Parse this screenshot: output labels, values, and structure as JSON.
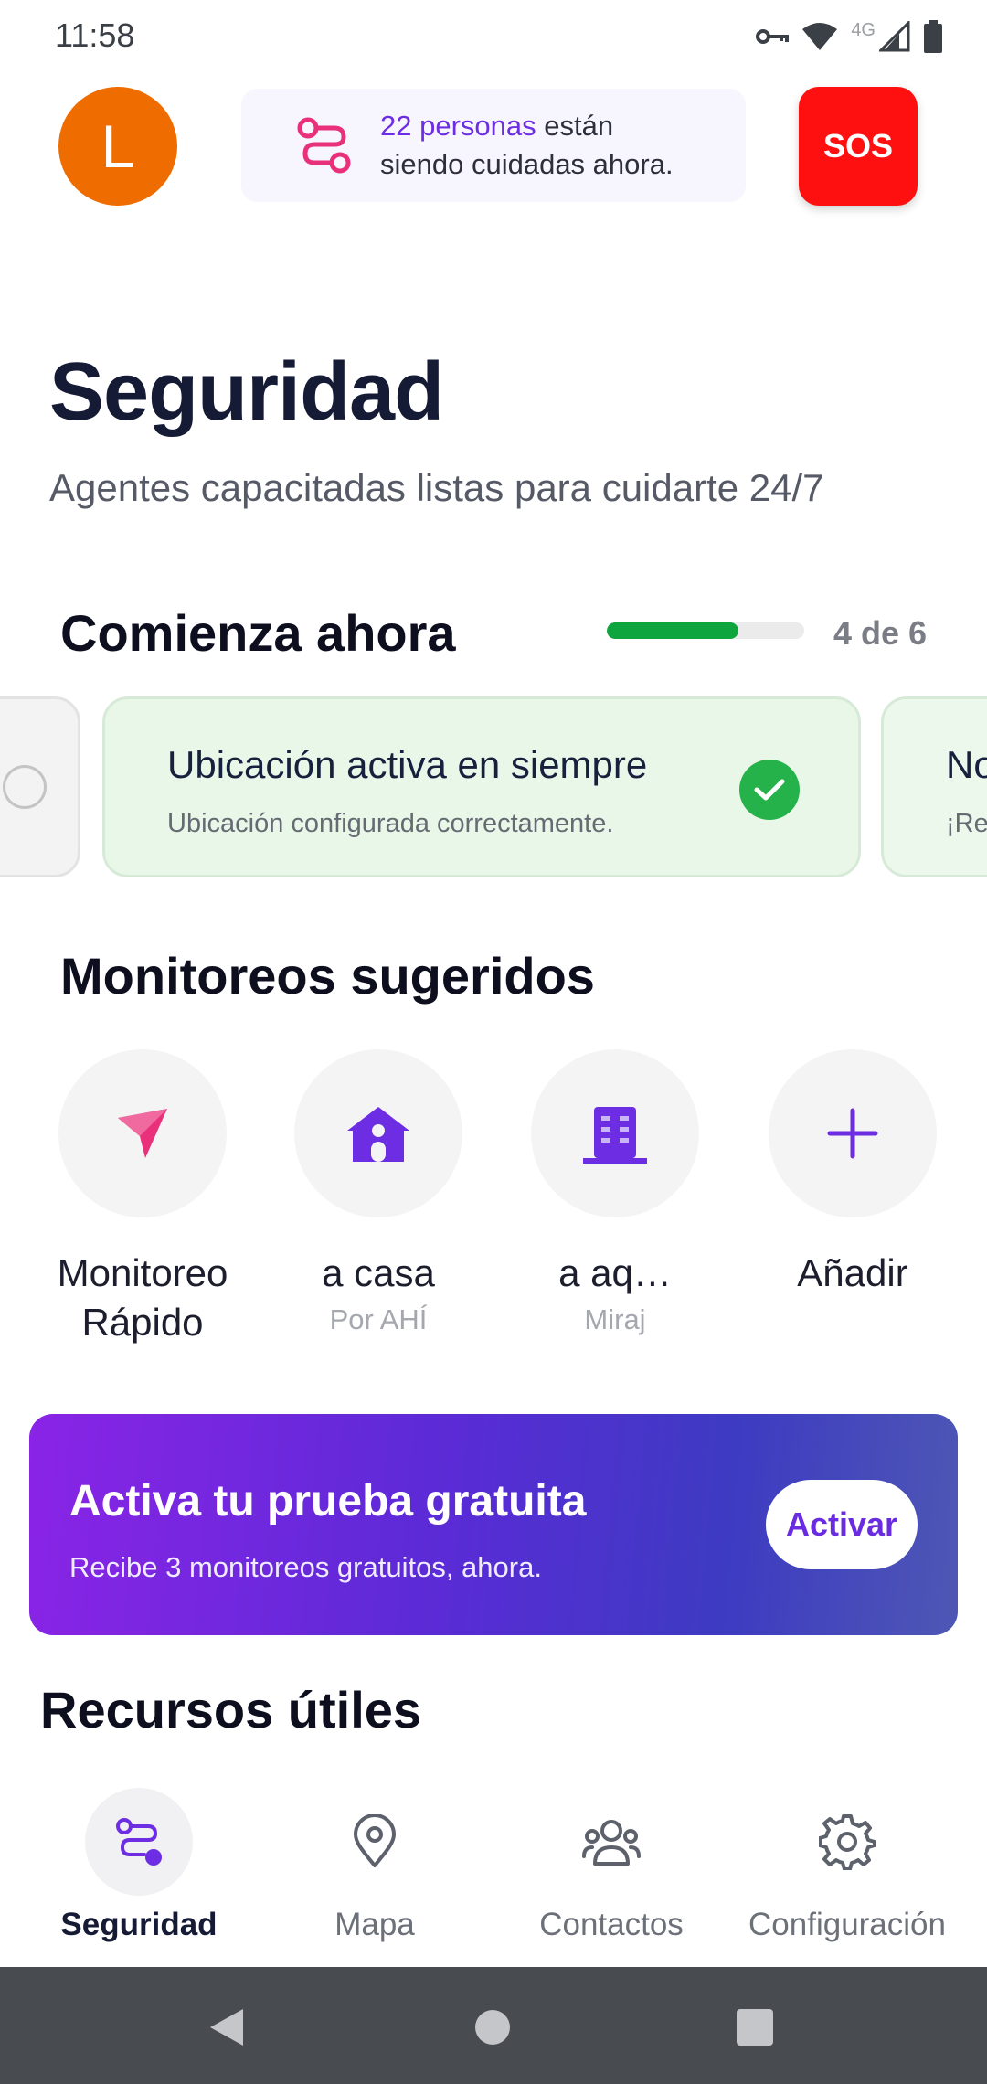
{
  "status_bar": {
    "time": "11:58",
    "network_label": "4G"
  },
  "header": {
    "avatar_letter": "L",
    "care_count": "22 personas",
    "care_text_1": " están",
    "care_text_2": "siendo cuidadas ahora.",
    "sos_label": "SOS"
  },
  "hero": {
    "title": "Seguridad",
    "subtitle": "Agentes capacitadas listas para cuidarte 24/7"
  },
  "start": {
    "title": "Comienza ahora",
    "progress_text": "4 de 6",
    "progress_fraction": 0.667,
    "cards": [
      {
        "title": "Ubicación activa en siempre",
        "description": "Ubicación configurada correctamente."
      },
      {
        "title": "No",
        "description": "¡Re"
      }
    ]
  },
  "suggested": {
    "title": "Monitoreos sugeridos",
    "items": [
      {
        "label": "Monitoreo Rápido",
        "sub": "",
        "icon": "send-arrow-icon"
      },
      {
        "label": "a casa",
        "sub": "Por AHÍ",
        "icon": "house-icon"
      },
      {
        "label": "a aq…",
        "sub": "Miraj",
        "icon": "building-icon"
      },
      {
        "label": "Añadir",
        "sub": "",
        "icon": "plus-icon"
      }
    ]
  },
  "promo": {
    "title": "Activa tu prueba gratuita",
    "subtitle": "Recibe 3 monitoreos gratuitos, ahora.",
    "button": "Activar"
  },
  "resources": {
    "title": "Recursos útiles"
  },
  "bottom_nav": [
    {
      "label": "Seguridad",
      "icon": "route-icon",
      "active": true
    },
    {
      "label": "Mapa",
      "icon": "map-pin-icon",
      "active": false
    },
    {
      "label": "Contactos",
      "icon": "contacts-icon",
      "active": false
    },
    {
      "label": "Configuración",
      "icon": "gear-icon",
      "active": false
    }
  ],
  "colors": {
    "accent": "#6d2de2",
    "sos": "#ff1010",
    "avatar": "#ef6c00",
    "success": "#26b24b",
    "progress": "#0ea53f"
  }
}
